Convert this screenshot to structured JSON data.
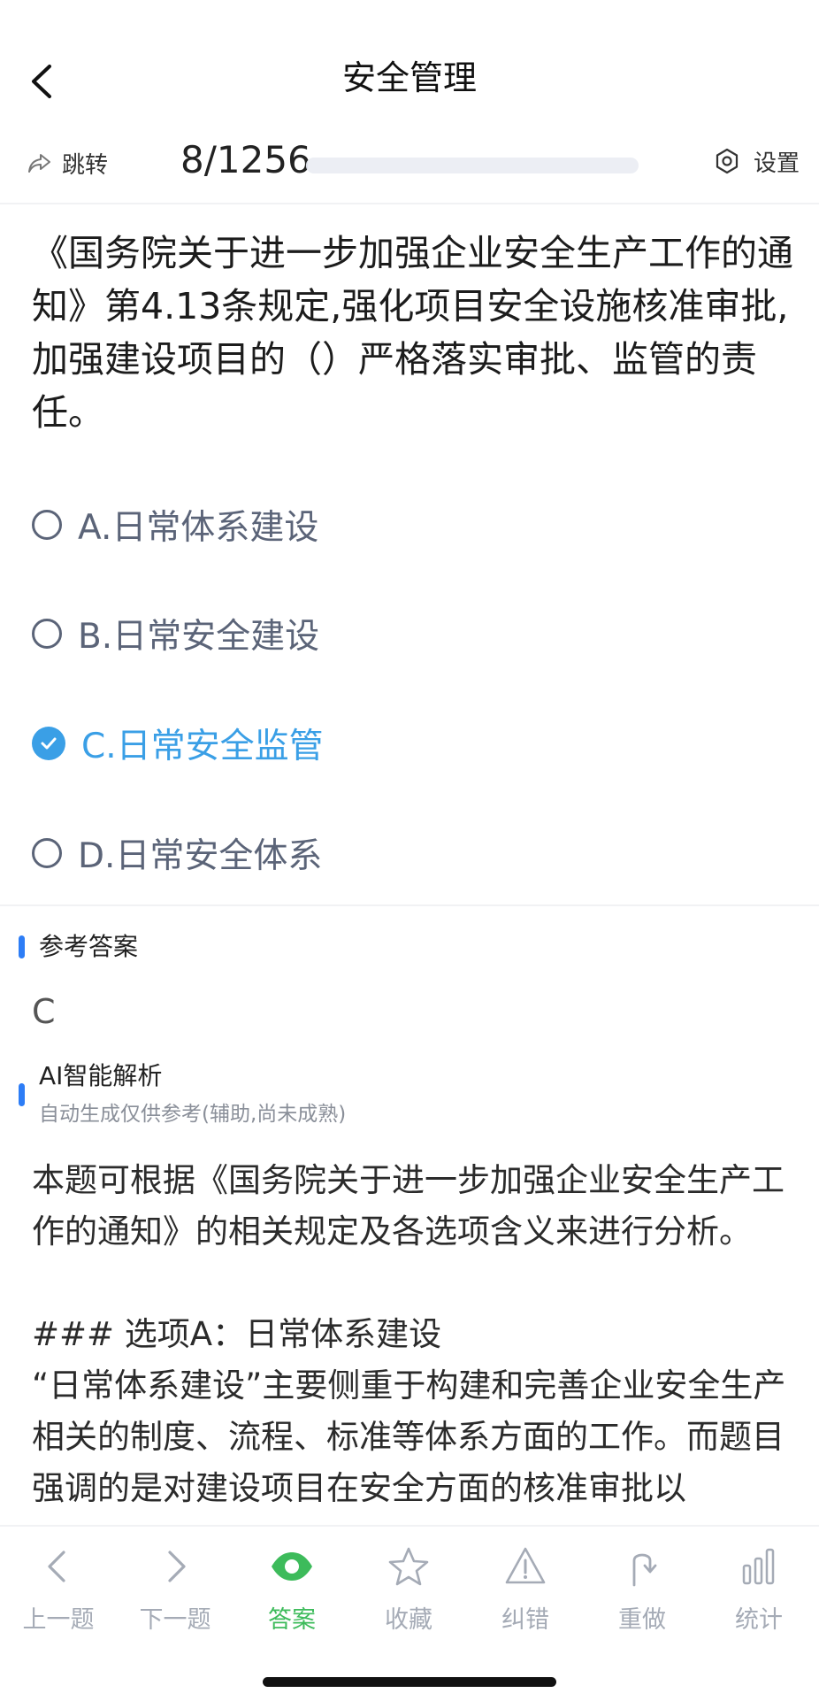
{
  "header": {
    "title": "安全管理"
  },
  "subbar": {
    "jump_label": "跳转",
    "progress_text": "8/1256",
    "progress_fraction": 0.0064,
    "settings_label": "设置"
  },
  "question": {
    "text": "《国务院关于进一步加强企业安全生产工作的通知》第4.13条规定,强化项目安全设施核准审批,加强建设项目的（）严格落实审批、监管的责任。"
  },
  "options": [
    {
      "label": "A.日常体系建设",
      "selected": false
    },
    {
      "label": "B.日常安全建设",
      "selected": false
    },
    {
      "label": "C.日常安全监管",
      "selected": true
    },
    {
      "label": "D.日常安全体系",
      "selected": false
    }
  ],
  "reference": {
    "title": "参考答案",
    "answer": "C"
  },
  "ai": {
    "title": "AI智能解析",
    "subtitle": "自动生成仅供参考(辅助,尚未成熟)",
    "analysis": "本题可根据《国务院关于进一步加强企业安全生产工作的通知》的相关规定及各选项含义来进行分析。\n\n### 选项A：日常体系建设\n“日常体系建设”主要侧重于构建和完善企业安全生产相关的制度、流程、标准等体系方面的工作。而题目强调的是对建设项目在安全方面的核准审批以"
  },
  "tabs": [
    {
      "label": "上一题",
      "icon": "chevron-left-icon"
    },
    {
      "label": "下一题",
      "icon": "chevron-right-icon"
    },
    {
      "label": "答案",
      "icon": "eye-icon"
    },
    {
      "label": "收藏",
      "icon": "star-icon"
    },
    {
      "label": "纠错",
      "icon": "warning-icon"
    },
    {
      "label": "重做",
      "icon": "redo-icon"
    },
    {
      "label": "统计",
      "icon": "bar-chart-icon"
    }
  ],
  "colors": {
    "accent": "#3a9fe6",
    "active_tab": "#3dbb5b",
    "section_bar": "#2d7df6",
    "tab_inactive": "#a5abb6"
  }
}
